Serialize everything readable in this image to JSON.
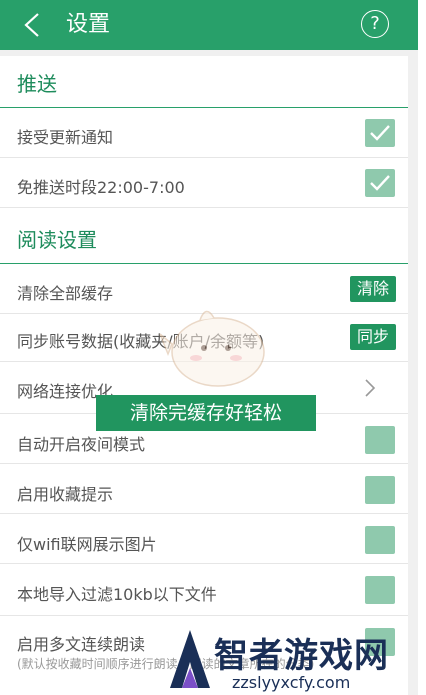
{
  "header": {
    "title": "设置"
  },
  "sections": {
    "push": {
      "title": "推送",
      "rows": [
        {
          "label": "接受更新通知",
          "checked": true
        },
        {
          "label": "免推送时段22:00-7:00",
          "checked": true
        }
      ]
    },
    "reading": {
      "title": "阅读设置",
      "rows": [
        {
          "label": "清除全部缓存",
          "button": "清除"
        },
        {
          "label": "同步账号数据(收藏夹/账户/余额等)",
          "button": "同步"
        },
        {
          "label": "网络连接优化"
        },
        {
          "label": "自动开启夜间模式",
          "checked": false
        },
        {
          "label": "启用收藏提示",
          "checked": false
        },
        {
          "label": "仅wifi联网展示图片",
          "checked": false
        },
        {
          "label": "本地导入过滤10kb以下文件",
          "checked": false
        },
        {
          "label": "启用多文连续朗读",
          "checked": false,
          "note": "(默认按收藏时间顺序进行朗读，朗读的文章所在的分类)"
        }
      ]
    }
  },
  "toast": "清除完缓存好轻松",
  "watermark": {
    "brand": "智者游戏网",
    "url": "zzslyyxcfy.com"
  },
  "colors": {
    "accent": "#28a06a",
    "checkbox": "#8fc9ad"
  }
}
